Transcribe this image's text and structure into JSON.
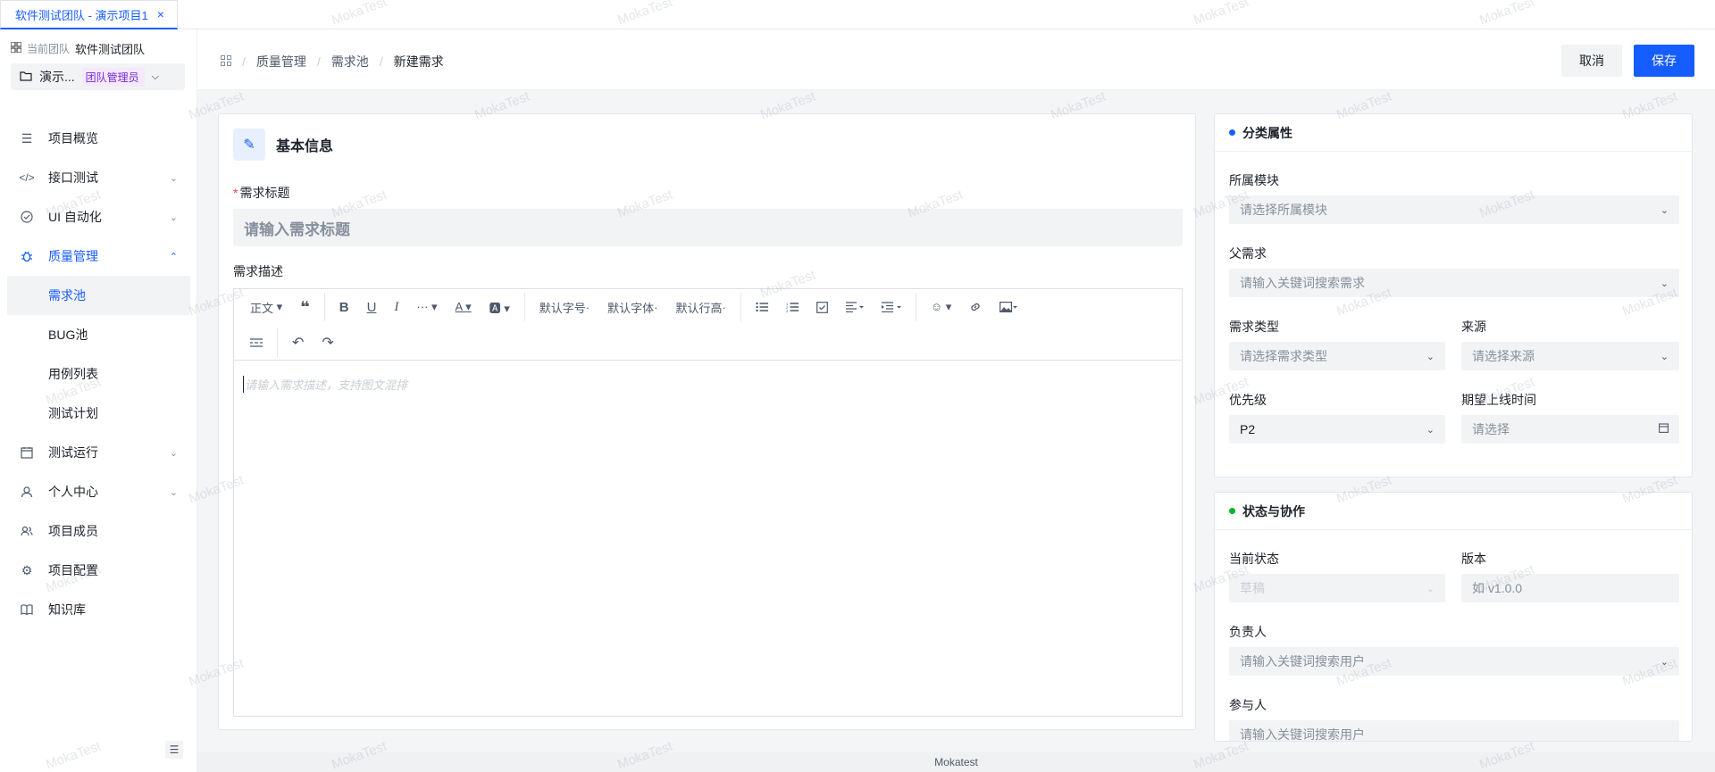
{
  "tab": {
    "label": "软件测试团队 - 演示项目1",
    "close": "×"
  },
  "team": {
    "prefix": "当前团队",
    "name": "软件测试团队"
  },
  "project": {
    "name": "演示...",
    "tag": "团队管理员"
  },
  "menu": {
    "overview": "项目概览",
    "api": "接口测试",
    "ui": "UI 自动化",
    "quality": "质量管理",
    "quality_sub": [
      "需求池",
      "BUG池",
      "用例列表",
      "测试计划"
    ],
    "run": "测试运行",
    "personal": "个人中心",
    "members": "项目成员",
    "config": "项目配置",
    "kb": "知识库"
  },
  "breadcrumb": [
    "质量管理",
    "需求池",
    "新建需求"
  ],
  "actions": {
    "cancel": "取消",
    "save": "保存"
  },
  "basic": {
    "title": "基本信息",
    "title_label": "需求标题",
    "title_placeholder": "请输入需求标题",
    "desc_label": "需求描述",
    "desc_placeholder": "请输入需求描述，支持图文混排"
  },
  "toolbar": {
    "paragraph": "正文",
    "font_size": "默认字号",
    "font_family": "默认字体",
    "line_height": "默认行高"
  },
  "classify": {
    "title": "分类属性",
    "module_label": "所属模块",
    "module_placeholder": "请选择所属模块",
    "parent_label": "父需求",
    "parent_placeholder": "请输入关键词搜索需求",
    "type_label": "需求类型",
    "type_placeholder": "请选择需求类型",
    "source_label": "来源",
    "source_placeholder": "请选择来源",
    "priority_label": "优先级",
    "priority_value": "P2",
    "online_label": "期望上线时间",
    "online_placeholder": "请选择"
  },
  "status": {
    "title": "状态与协作",
    "state_label": "当前状态",
    "state_value": "草稿",
    "version_label": "版本",
    "version_placeholder": "如 v1.0.0",
    "owner_label": "负责人",
    "owner_placeholder": "请输入关键词搜索用户",
    "participants_label": "参与人",
    "participants_placeholder": "请输入关键词搜索用户"
  },
  "footer": "Mokatest",
  "watermark": "MokaTest",
  "colors": {
    "primary": "#165dff",
    "required": "#f53f3f",
    "dot_blue": "#165dff",
    "dot_green": "#00b42a"
  }
}
